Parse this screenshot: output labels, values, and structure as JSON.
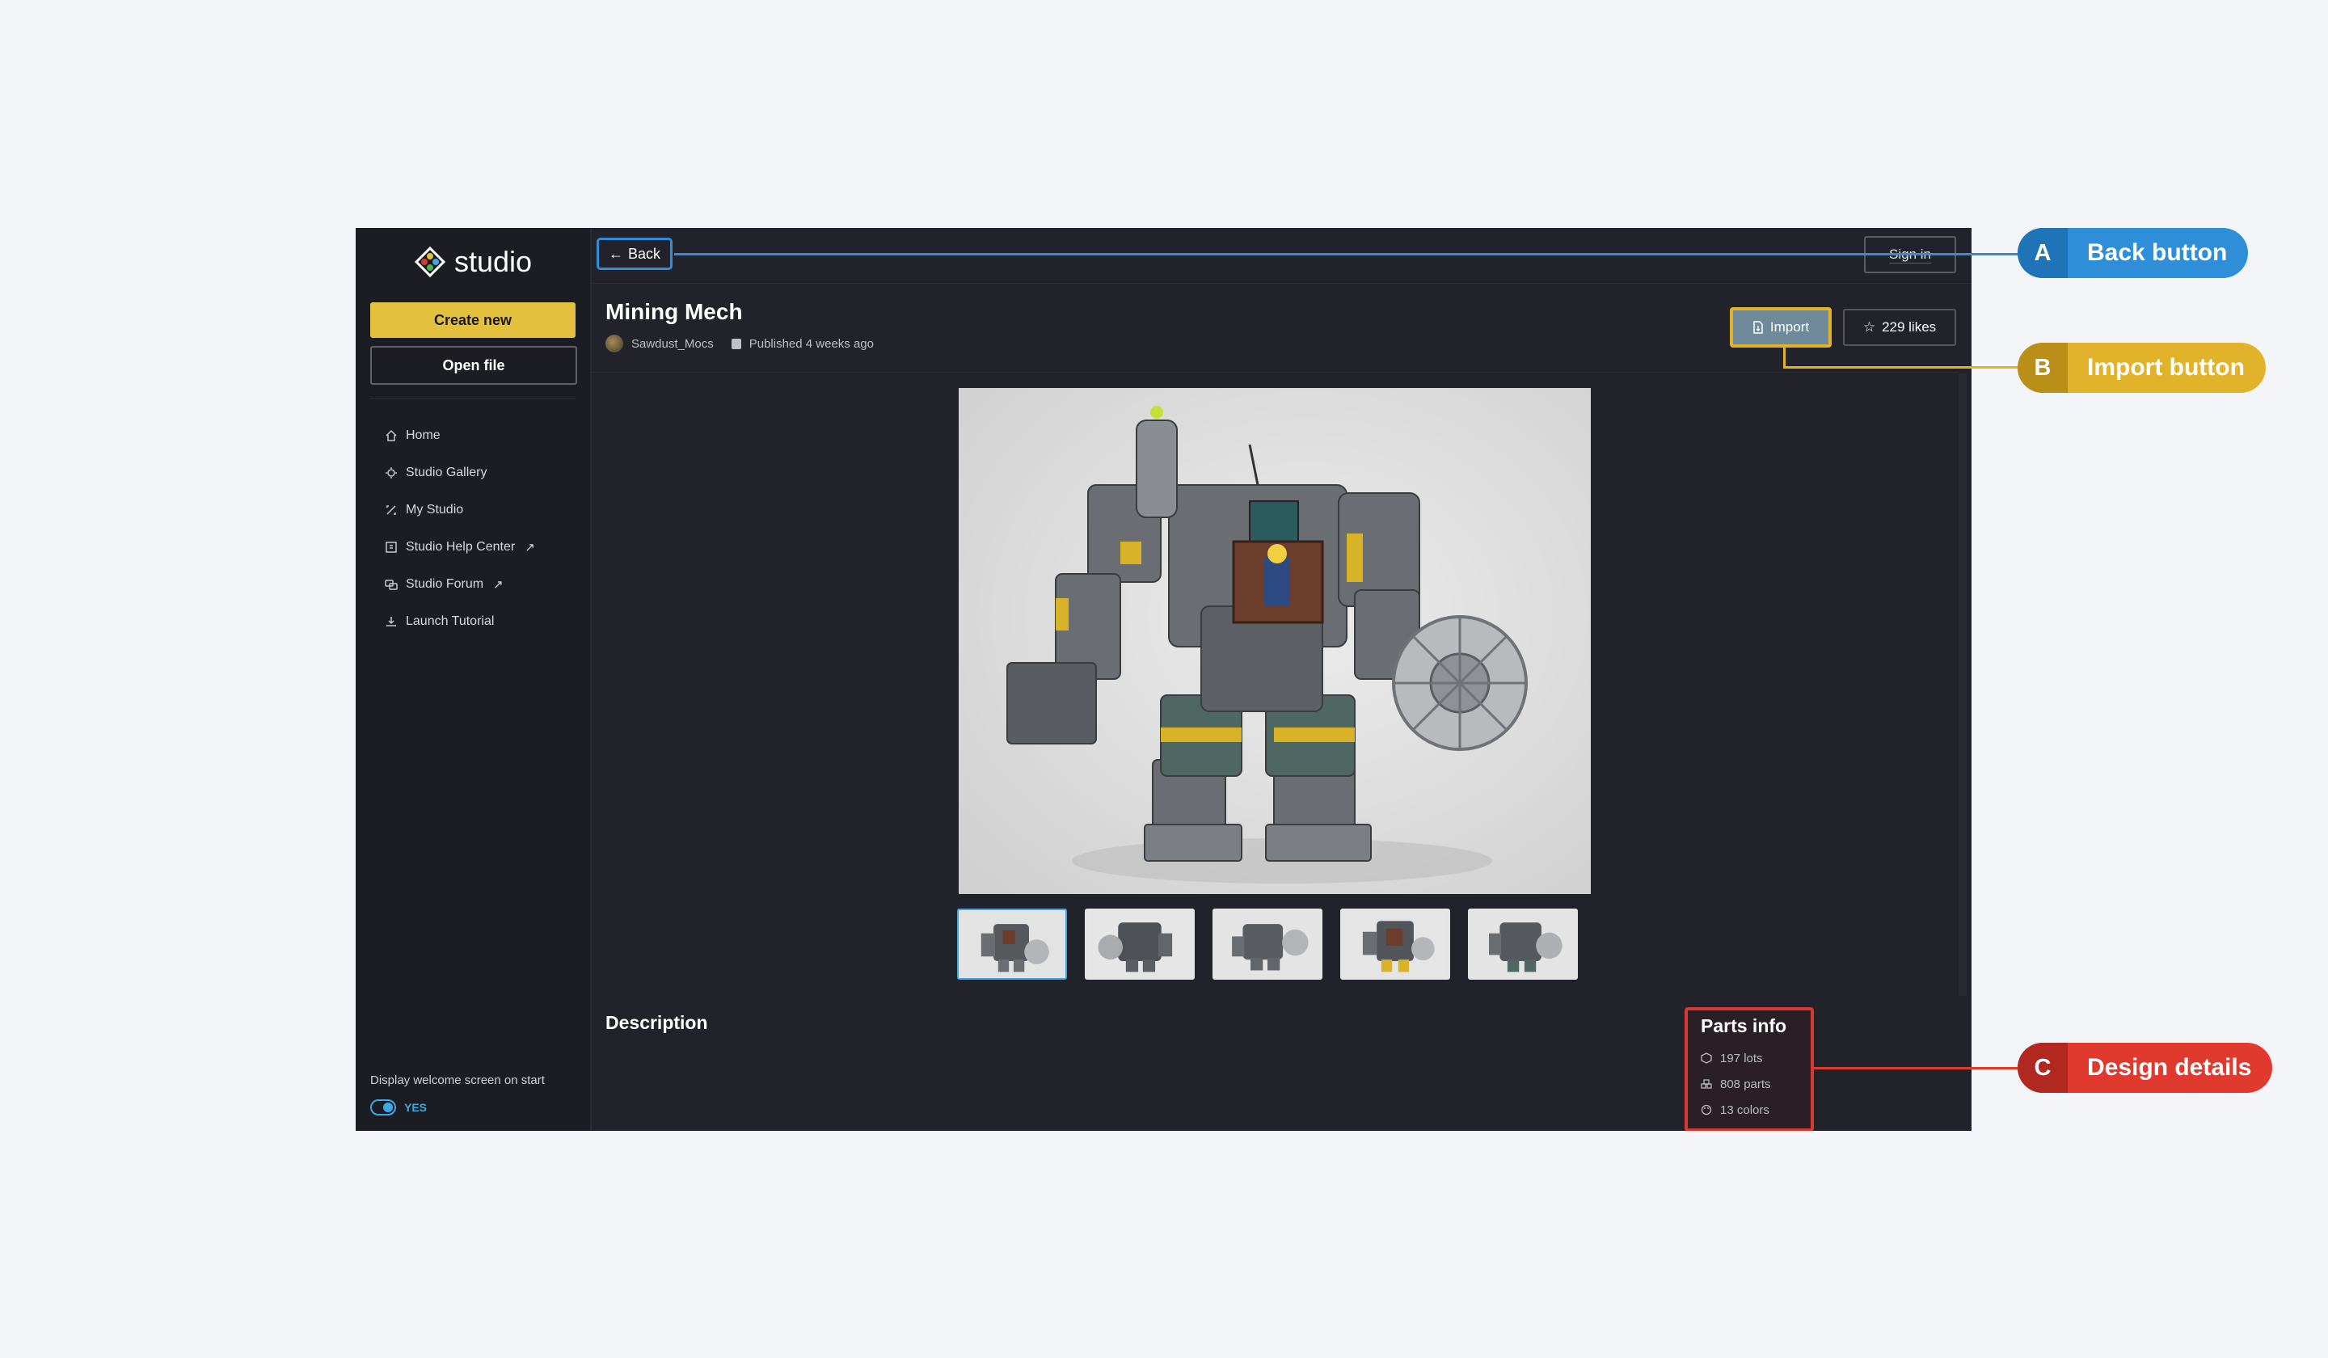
{
  "app": {
    "logo_text": "studio",
    "create_new_label": "Create new",
    "open_file_label": "Open file",
    "back_label": "Back",
    "sign_in_label": "Sign in"
  },
  "sidebar": {
    "items": [
      {
        "label": "Home",
        "icon": "home-icon"
      },
      {
        "label": "Studio Gallery",
        "icon": "gallery-icon"
      },
      {
        "label": "My Studio",
        "icon": "my-studio-icon"
      },
      {
        "label": "Studio Help Center",
        "icon": "help-center-icon",
        "external": true
      },
      {
        "label": "Studio Forum",
        "icon": "forum-icon",
        "external": true
      },
      {
        "label": "Launch Tutorial",
        "icon": "tutorial-icon"
      }
    ],
    "external_glyph": "↗",
    "welcome_label": "Display welcome screen on start",
    "toggle_value": "YES"
  },
  "design": {
    "title": "Mining Mech",
    "author": "Sawdust_Mocs",
    "published": "Published 4 weeks ago",
    "import_label": "Import",
    "likes_label": "229 likes",
    "thumbnails_count": 5,
    "active_thumbnail": 1,
    "description_title": "Description"
  },
  "parts_info": {
    "title": "Parts info",
    "lots": "197 lots",
    "parts": "808 parts",
    "colors": "13 colors"
  },
  "annotations": [
    {
      "letter": "A",
      "label": "Back button",
      "color": "#2e8fd8"
    },
    {
      "letter": "B",
      "label": "Import button",
      "color": "#e0b32a"
    },
    {
      "letter": "C",
      "label": "Design details",
      "color": "#e03a2f"
    }
  ],
  "colors": {
    "accent_yellow": "#e3c03d",
    "accent_blue": "#3fa7e6",
    "background": "#22232a"
  }
}
